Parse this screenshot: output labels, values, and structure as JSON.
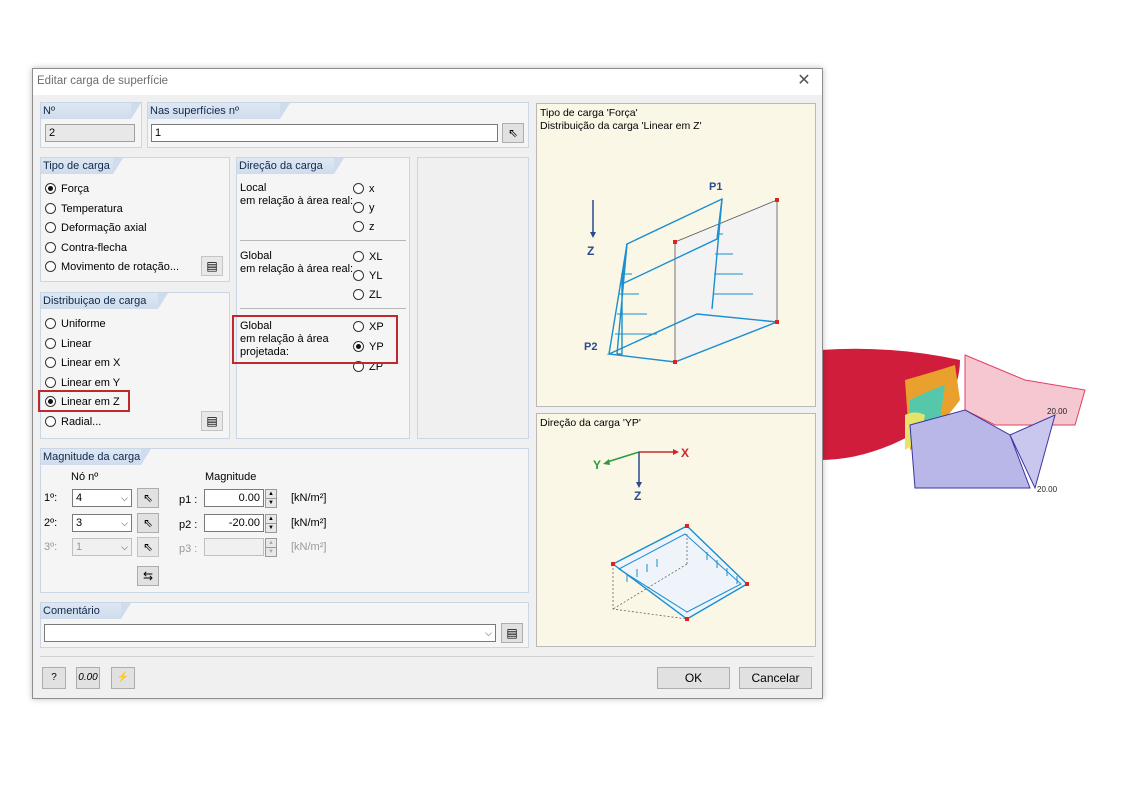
{
  "dialog": {
    "title": "Editar carga de superfície"
  },
  "no": {
    "label": "Nº",
    "value": "2"
  },
  "surfaces": {
    "label": "Nas superfícies nº",
    "value": "1"
  },
  "load_type": {
    "label": "Tipo de carga",
    "options": [
      "Força",
      "Temperatura",
      "Deformação axial",
      "Contra-flecha",
      "Movimento de rotação..."
    ],
    "selected": "Força"
  },
  "load_direction": {
    "label": "Direção da carga",
    "local_label": "Local",
    "local_sub": "em relação à área real:",
    "local_options": [
      "x",
      "y",
      "z"
    ],
    "global_label": "Global",
    "global_sub": "em relação à área real:",
    "global_options": [
      "XL",
      "YL",
      "ZL"
    ],
    "proj_label": "Global",
    "proj_sub1": "em relação à área",
    "proj_sub2": "projetada:",
    "proj_options": [
      "XP",
      "YP",
      "ZP"
    ],
    "selected": "YP"
  },
  "distribution": {
    "label": "Distribuiçao de carga",
    "options": [
      "Uniforme",
      "Linear",
      "Linear em X",
      "Linear em Y",
      "Linear em Z",
      "Radial..."
    ],
    "selected": "Linear em Z"
  },
  "magnitude": {
    "label": "Magnitude da carga",
    "node_header": "Nó nº",
    "mag_header": "Magnitude",
    "rows": [
      {
        "label": "1º:",
        "node": "4",
        "p": "p1 :",
        "value": "0.00",
        "unit": "[kN/m²]"
      },
      {
        "label": "2º:",
        "node": "3",
        "p": "p2 :",
        "value": "-20.00",
        "unit": "[kN/m²]"
      },
      {
        "label": "3º:",
        "node": "1",
        "p": "p3 :",
        "value": "",
        "unit": "[kN/m²]"
      }
    ]
  },
  "comment": {
    "label": "Comentário",
    "value": ""
  },
  "preview_top": {
    "line1": "Tipo de carga 'Força'",
    "line2": "Distribuição da carga 'Linear em Z'",
    "p1": "P1",
    "p2": "P2",
    "axis_z": "Z"
  },
  "preview_bottom": {
    "line1": "Direção da carga 'YP'",
    "axis_x": "X",
    "axis_y": "Y",
    "axis_z": "Z"
  },
  "buttons": {
    "ok": "OK",
    "cancel": "Cancelar"
  },
  "background": {
    "label1": "20.00",
    "label2": "20.00"
  },
  "colors": {
    "header_text": "#10284a",
    "highlight": "#c0282d",
    "diagram": "#1a8fd0"
  }
}
